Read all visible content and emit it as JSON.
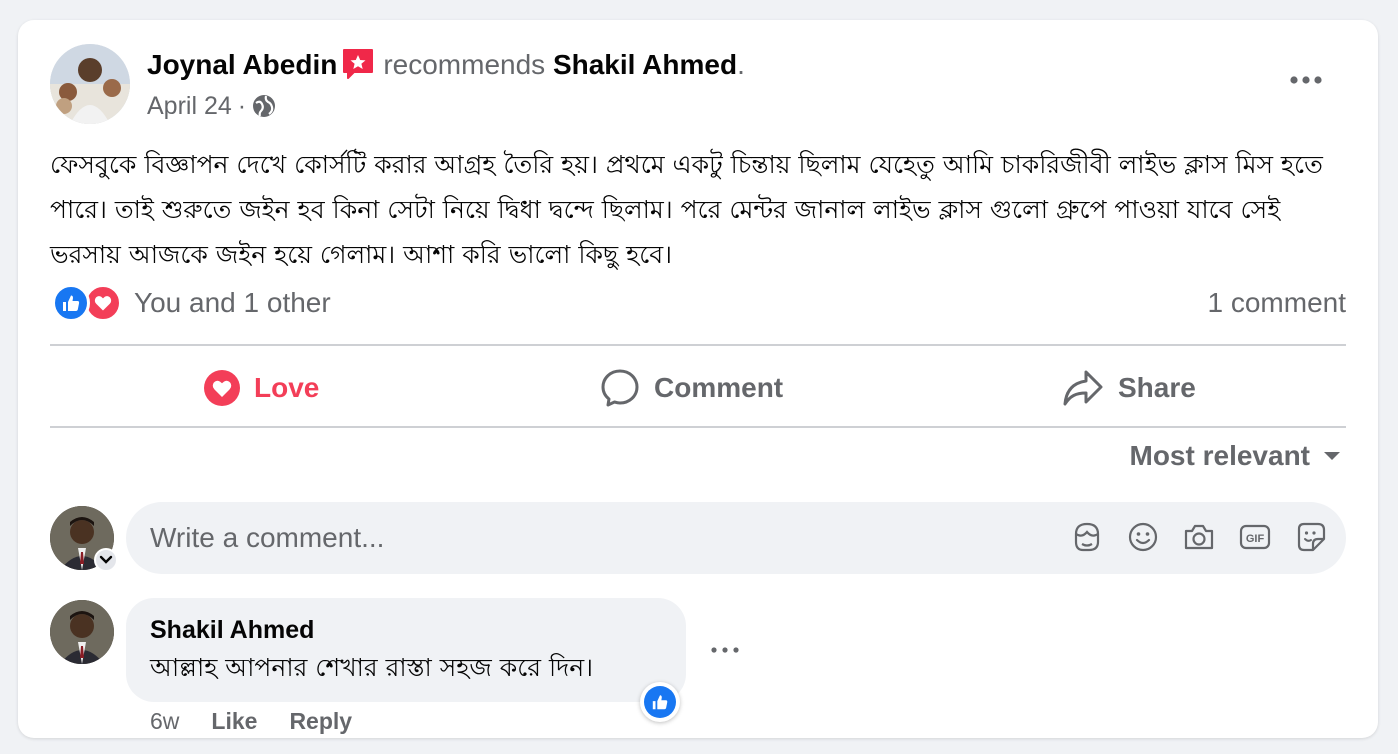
{
  "post": {
    "author": "Joynal Abedin",
    "verb": "recommends",
    "target": "Shakil Ahmed",
    "target_suffix": ".",
    "date": "April 24",
    "separator": "·",
    "audience_icon": "globe-icon",
    "text": "ফেসবুকে বিজ্ঞাপন দেখে কোর্সটি করার আগ্রহ তৈরি হয়। প্রথমে একটু চিন্তায় ছিলাম যেহেতু আমি চাকরিজীবী লাইভ ক্লাস মিস হতে পারে। তাই শুরুতে জইন হব কিনা সেটা নিয়ে দ্বিধা দ্বন্দে ছিলাম। পরে মেন্টর জানাল লাইভ ক্লাস গুলো গ্রুপে পাওয়া যাবে সেই ভরসায় আজকে জইন হয়ে গেলাম। আশা করি ভালো কিছু হবে।"
  },
  "reactions": {
    "summary": "You and 1 other",
    "types": [
      "like",
      "love"
    ],
    "comment_count": "1 comment"
  },
  "actions": {
    "love": "Love",
    "comment": "Comment",
    "share": "Share"
  },
  "sort": {
    "label": "Most relevant"
  },
  "composer": {
    "placeholder": "Write a comment...",
    "icons": [
      "avatar-sticker-icon",
      "emoji-icon",
      "camera-icon",
      "gif-icon",
      "sticker-icon"
    ]
  },
  "comments": [
    {
      "author": "Shakil Ahmed",
      "text": "আল্লাহ আপনার শেখার রাস্তা সহজ করে দিন।",
      "time": "6w",
      "like_label": "Like",
      "reply_label": "Reply",
      "reaction": "like"
    }
  ],
  "colors": {
    "like_blue": "#1877f2",
    "love_red": "#f33e58",
    "muted": "#65676b",
    "badge_pink": "#f02849"
  }
}
